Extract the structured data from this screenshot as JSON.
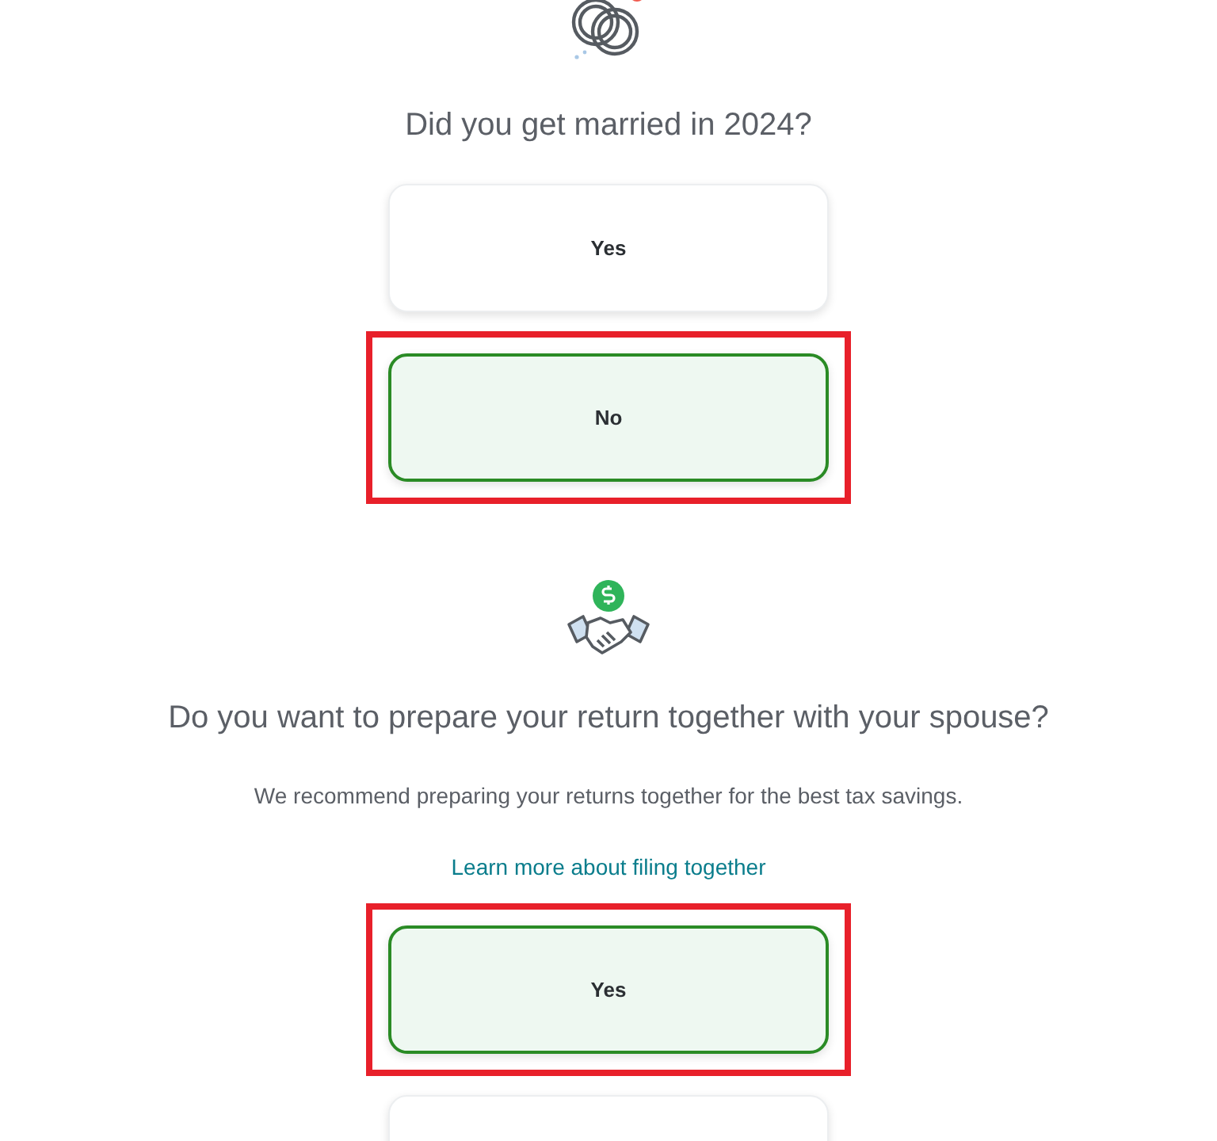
{
  "sections": [
    {
      "kind": "rings",
      "question": "Did you get married in 2024?",
      "options": [
        {
          "label": "Yes",
          "selected": false,
          "highlighted": false
        },
        {
          "label": "No",
          "selected": true,
          "highlighted": true
        }
      ]
    },
    {
      "kind": "handshake",
      "question": "Do you want to prepare your return together with your spouse?",
      "note": "We recommend preparing your returns together for the best tax savings.",
      "link": "Learn more about filing together",
      "options": [
        {
          "label": "Yes",
          "selected": true,
          "highlighted": true
        },
        {
          "selected": false,
          "highlighted": false
        }
      ]
    }
  ]
}
